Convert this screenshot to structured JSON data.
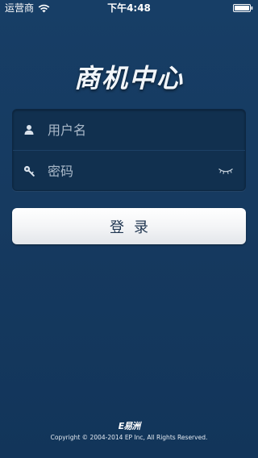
{
  "status_bar": {
    "carrier": "运营商",
    "time": "下午4:48",
    "wifi_icon": "wifi-icon",
    "battery_icon": "battery-icon"
  },
  "app": {
    "title": "商机中心"
  },
  "login_form": {
    "username": {
      "placeholder": "用户名",
      "value": "",
      "icon": "user-icon"
    },
    "password": {
      "placeholder": "密码",
      "value": "",
      "icon": "key-icon",
      "toggle_icon": "eye-closed-icon"
    },
    "submit_label": "登录"
  },
  "footer": {
    "logo_text": "E易洲",
    "copyright": "Copyright © 2004-2014 EP Inc, All Rights Reserved."
  },
  "colors": {
    "background": "#173c63",
    "field_background": "#11304f",
    "button_text": "#1f3550",
    "placeholder": "#aab9c9"
  }
}
